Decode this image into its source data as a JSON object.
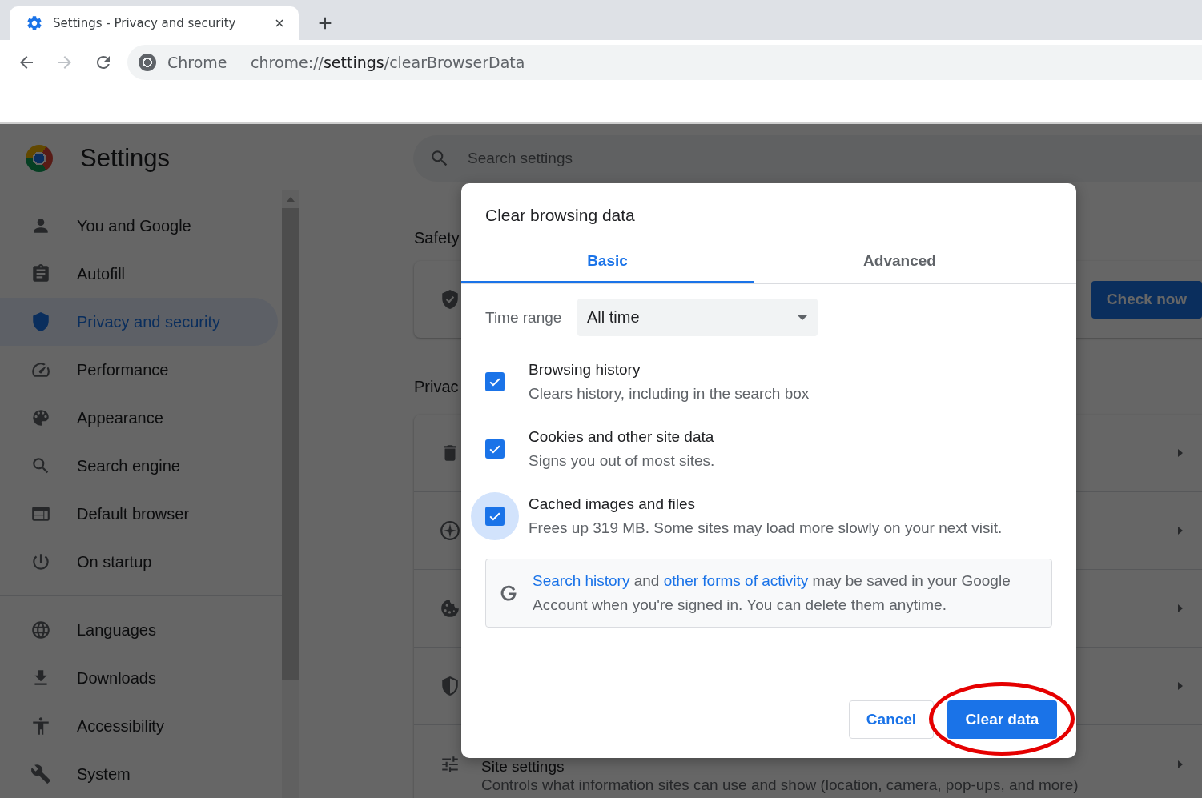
{
  "browser": {
    "tab": {
      "title": "Settings - Privacy and security"
    },
    "nav": {
      "back_disabled": false,
      "forward_disabled": true
    },
    "omnibox": {
      "site": "Chrome",
      "url": {
        "scheme": "chrome://",
        "host": "settings",
        "path": "/clearBrowserData"
      }
    }
  },
  "settings": {
    "title": "Settings",
    "search": {
      "placeholder": "Search settings"
    },
    "sidebar": {
      "sections": [
        {
          "items": [
            {
              "label": "You and Google",
              "selected": false
            },
            {
              "label": "Autofill",
              "selected": false
            },
            {
              "label": "Privacy and security",
              "selected": true
            },
            {
              "label": "Performance",
              "selected": false
            },
            {
              "label": "Appearance",
              "selected": false
            },
            {
              "label": "Search engine",
              "selected": false
            },
            {
              "label": "Default browser",
              "selected": false
            },
            {
              "label": "On startup",
              "selected": false
            }
          ]
        },
        {
          "items": [
            {
              "label": "Languages",
              "selected": false
            },
            {
              "label": "Downloads",
              "selected": false
            },
            {
              "label": "Accessibility",
              "selected": false
            },
            {
              "label": "System",
              "selected": false
            }
          ]
        }
      ]
    },
    "safety_heading": "Safety",
    "check_button": "Check now",
    "privacy_heading": "Privac",
    "site_settings": {
      "title": "Site settings",
      "description": "Controls what information sites can use and show (location, camera, pop-ups, and more)"
    }
  },
  "dialog": {
    "title": "Clear browsing data",
    "tabs": [
      {
        "label": "Basic",
        "selected": true
      },
      {
        "label": "Advanced",
        "selected": false
      }
    ],
    "time_range": {
      "label": "Time range",
      "value": "All time"
    },
    "options": [
      {
        "title": "Browsing history",
        "description": "Clears history, including in the search box",
        "checked": true,
        "focused": false
      },
      {
        "title": "Cookies and other site data",
        "description": "Signs you out of most sites.",
        "checked": true,
        "focused": false
      },
      {
        "title": "Cached images and files",
        "description": "Frees up 319 MB. Some sites may load more slowly on your next visit.",
        "checked": true,
        "focused": true
      }
    ],
    "info": [
      {
        "kind": "link",
        "text": "Search history"
      },
      {
        "kind": "text",
        "text": "and"
      },
      {
        "kind": "link",
        "text": "other forms of activity"
      },
      {
        "kind": "text",
        "text": "may be saved in your Google Account when you're signed in. You can delete them anytime."
      }
    ],
    "buttons": {
      "cancel": "Cancel",
      "confirm": "Clear data"
    }
  }
}
